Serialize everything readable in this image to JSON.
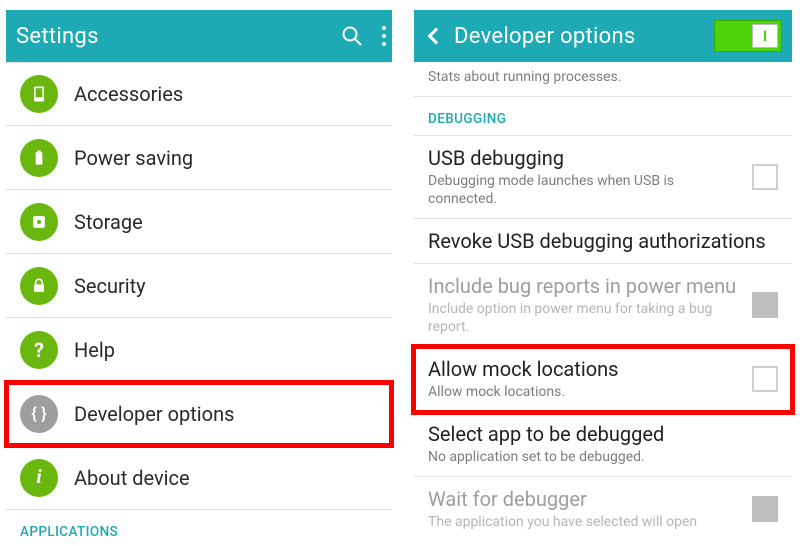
{
  "colors": {
    "accent": "#1eaab4",
    "icon_bg": "#6ab80f",
    "highlight": "#ff0000",
    "switch_on": "#4cd30a"
  },
  "left": {
    "title": "Settings",
    "items": [
      {
        "label": "Accessories",
        "icon": "accessories-icon"
      },
      {
        "label": "Power saving",
        "icon": "battery-icon"
      },
      {
        "label": "Storage",
        "icon": "storage-icon"
      },
      {
        "label": "Security",
        "icon": "lock-icon"
      },
      {
        "label": "Help",
        "icon": "help-icon"
      },
      {
        "label": "Developer options",
        "icon": "braces-icon",
        "highlight": true,
        "gray": true
      },
      {
        "label": "About device",
        "icon": "info-icon"
      }
    ],
    "section_header": "APPLICATIONS"
  },
  "right": {
    "title": "Developer options",
    "switch_on": true,
    "switch_label": "I",
    "cutoff": {
      "title_fragment": "",
      "subtitle": "Stats about running processes."
    },
    "section_header": "DEBUGGING",
    "items": [
      {
        "title": "USB debugging",
        "subtitle": "Debugging mode launches when USB is connected.",
        "checkbox": true
      },
      {
        "title": "Revoke USB debugging authorizations"
      },
      {
        "title": "Include bug reports in power menu",
        "subtitle": "Include option in power menu for taking a bug report.",
        "checkbox": true,
        "disabled": true
      },
      {
        "title": "Allow mock locations",
        "subtitle": "Allow mock locations.",
        "checkbox": true,
        "highlight": true
      },
      {
        "title": "Select app to be debugged",
        "subtitle": "No application set to be debugged."
      },
      {
        "title": "Wait for debugger",
        "subtitle": "The application you have selected will open",
        "checkbox": true,
        "disabled": true
      }
    ]
  }
}
